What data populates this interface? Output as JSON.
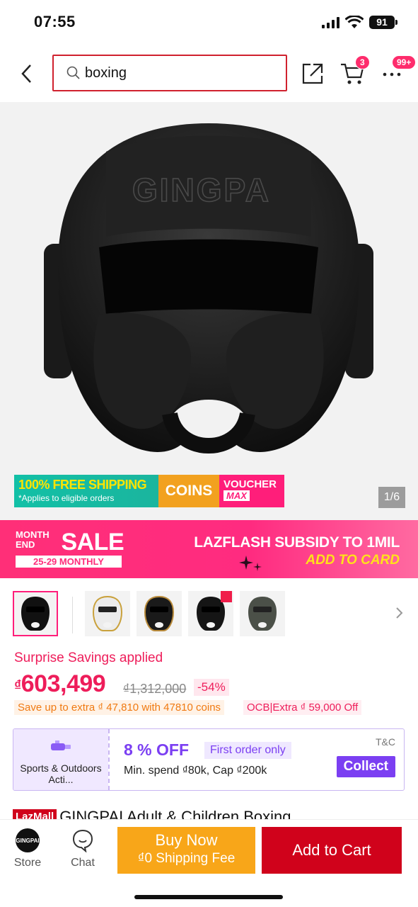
{
  "status": {
    "time": "07:55",
    "battery": "91"
  },
  "header": {
    "search_value": "boxing",
    "cart_count": "3",
    "more_badge": "99+"
  },
  "hero": {
    "brand_on_image": "GINGPA",
    "free_shipping": "100% FREE SHIPPING",
    "free_shipping_note": "*Applies to eligible orders",
    "coins": "COINS",
    "voucher": "VOUCHER",
    "voucher_max": "MAX",
    "image_counter": "1/6"
  },
  "sale_banner": {
    "month_end": "MONTH END",
    "sale": "SALE",
    "dates": "25-29 MONTHLY",
    "line1": "LAZFLASH SUBSIDY TO 1MIL",
    "line2": "ADD TO CARD"
  },
  "pricing": {
    "surprise": "Surprise Savings applied",
    "currency": "₫",
    "price": "603,499",
    "original": "₫1,312,000",
    "discount": "-54%",
    "coins_note": "Save up to extra ₫ 47,810 with 47810 coins",
    "ocb_note": "OCB|Extra ₫ 59,000 Off"
  },
  "voucher": {
    "category": "Sports & Outdoors Acti...",
    "percent": "8 % OFF",
    "first_order": "First order only",
    "min_spend": "Min. spend ₫80k, Cap ₫200k",
    "tc": "T&C",
    "collect": "Collect"
  },
  "product": {
    "mall_badge": "LazMall",
    "title": "GINGPAI Adult & Children Boxing"
  },
  "bottom": {
    "store_logo": "GINGPAI",
    "store": "Store",
    "chat": "Chat",
    "buy_now": "Buy Now",
    "shipping_fee": "₫0 Shipping Fee",
    "add_to_cart": "Add to Cart"
  },
  "colors": {
    "accent": "#ff1e7a",
    "price": "#ee1d5a",
    "buy_now": "#f8a619",
    "add_to_cart": "#d0021b",
    "voucher": "#7b3ff2"
  }
}
